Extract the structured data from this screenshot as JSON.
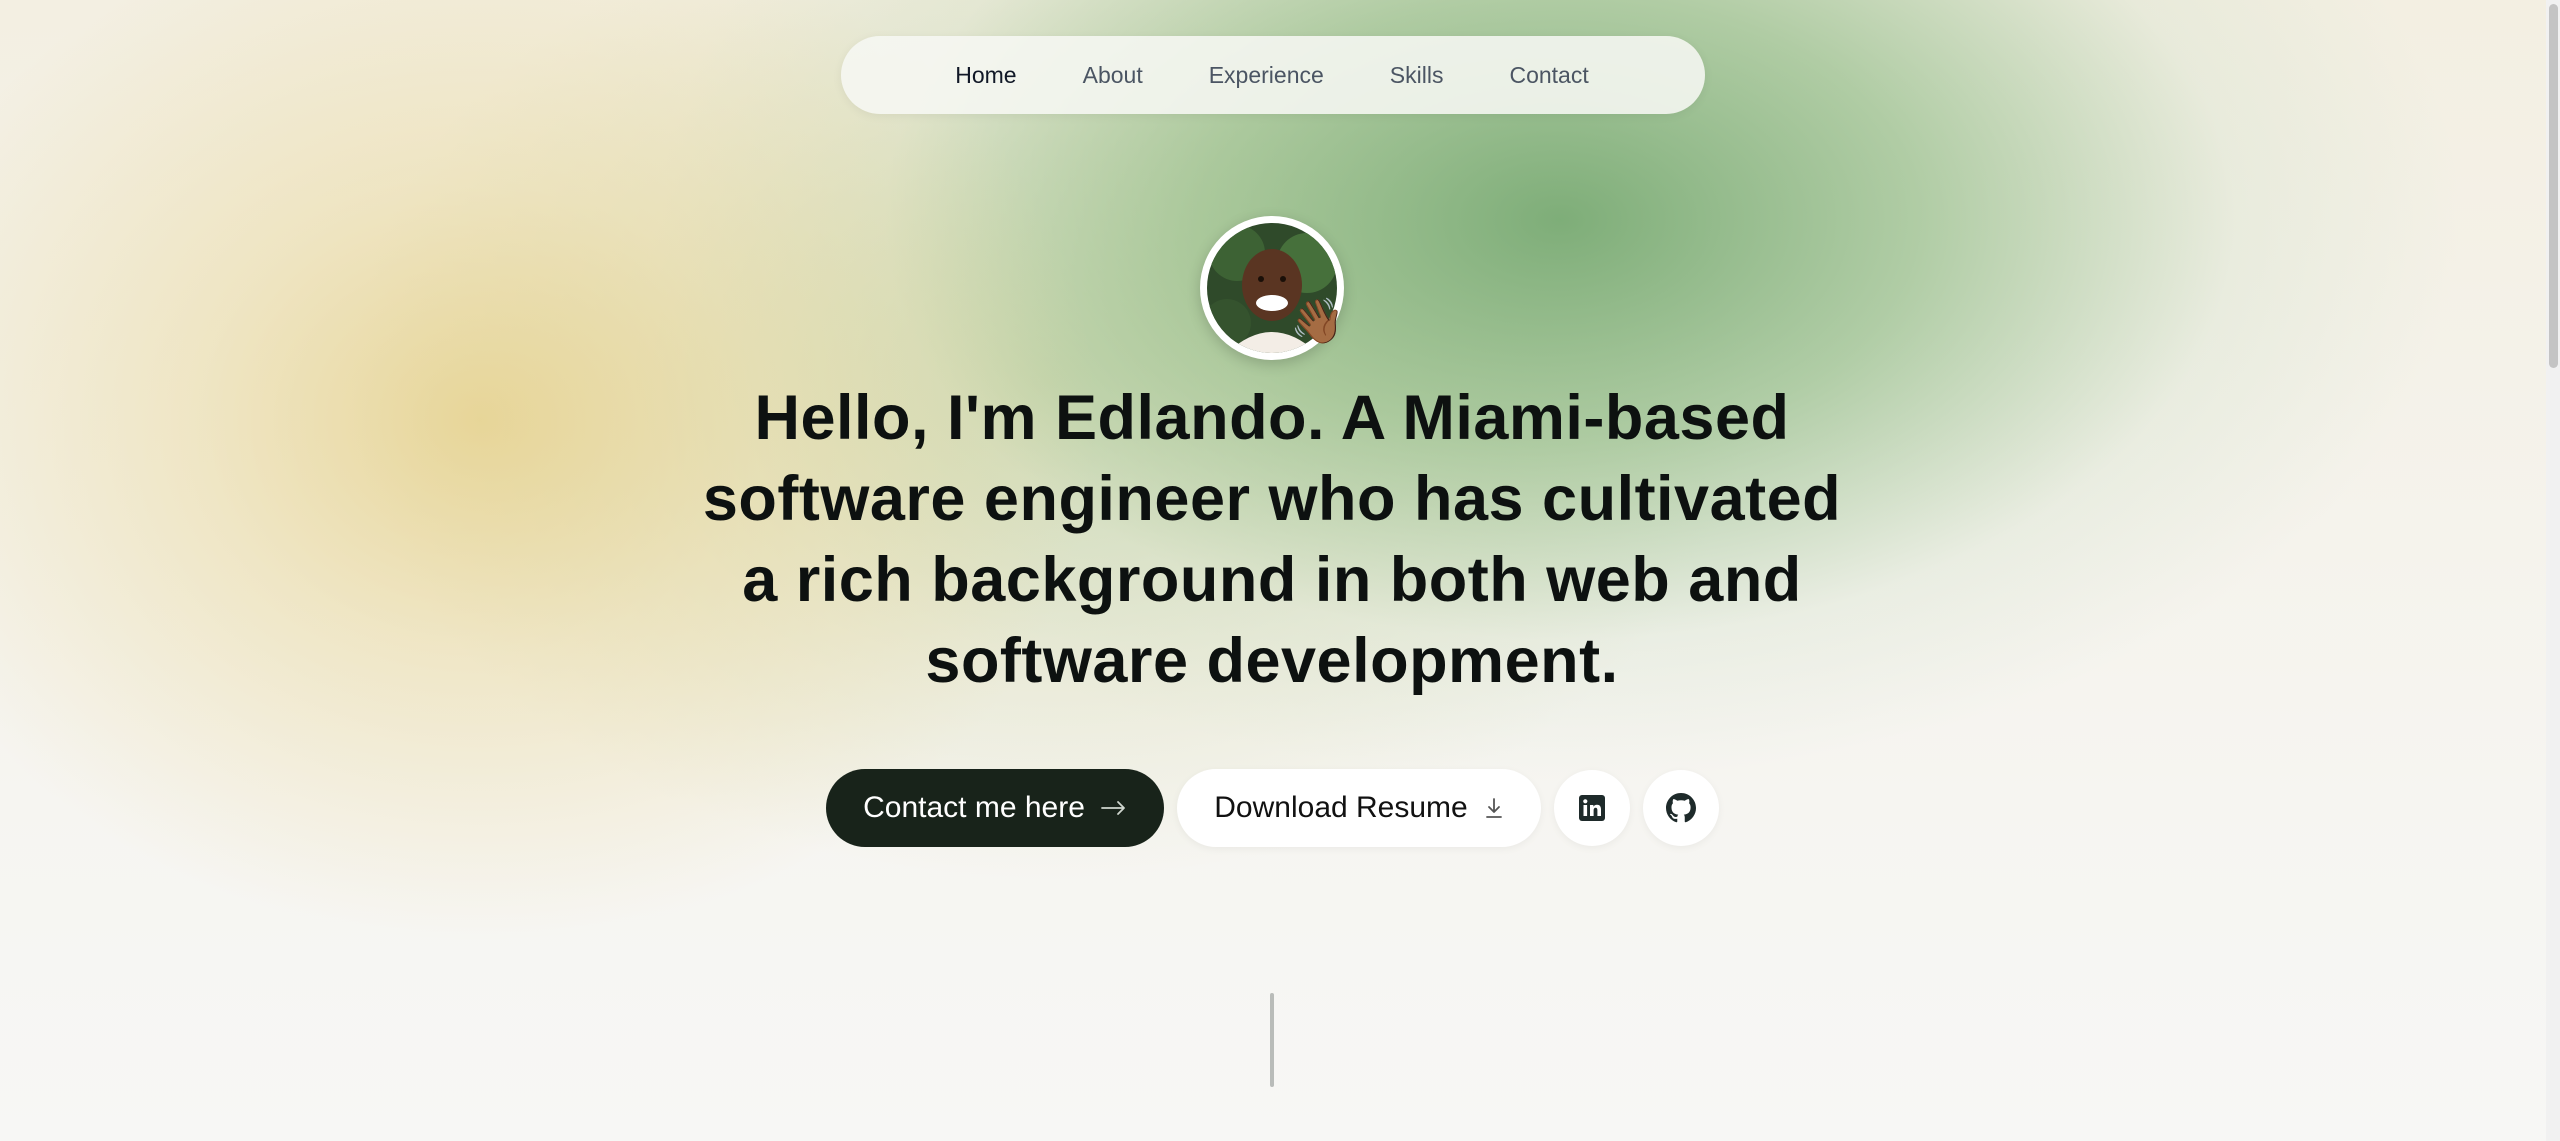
{
  "nav": {
    "items": [
      {
        "label": "Home",
        "active": true
      },
      {
        "label": "About",
        "active": false
      },
      {
        "label": "Experience",
        "active": false
      },
      {
        "label": "Skills",
        "active": false
      },
      {
        "label": "Contact",
        "active": false
      }
    ]
  },
  "hero": {
    "avatar_alt": "profile-photo",
    "wave_emoji": "👋🏾",
    "headline": {
      "part1_bold": "Hello, I'm Edlando.",
      "part2": " A Miami-based ",
      "part3_bold": "software engineer",
      "part4": " who has cultivated a rich background in both ",
      "part5_bold": "web",
      "part6": " and ",
      "part7_bold": "software development",
      "part8": "."
    },
    "contact_button": "Contact me here",
    "resume_button": "Download Resume",
    "linkedin_icon": "linkedin-icon",
    "github_icon": "github-icon"
  },
  "colors": {
    "primary_button": "#18231a",
    "text": "#0d1110",
    "nav_muted": "#4b5563"
  }
}
